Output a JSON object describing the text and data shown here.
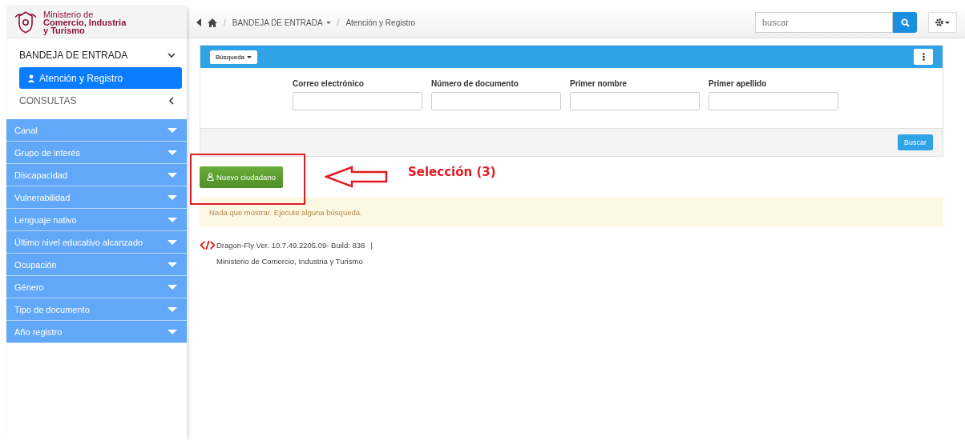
{
  "brand": {
    "lines": [
      "Ministerio de",
      "Comercio, Industria",
      "y Turismo"
    ]
  },
  "nav": [
    {
      "label": "BANDEJA DE ENTRADA",
      "expanded": true,
      "children": [
        {
          "label": "Atención y Registro",
          "selected": true
        }
      ]
    },
    {
      "label": "CONSULTAS",
      "expanded": false
    }
  ],
  "filters": [
    "Canal",
    "Grupo de interés",
    "Discapacidad",
    "Vulnerabilidad",
    "Lenguaje nativo",
    "Último nivel educativo alcanzado",
    "Ocupación",
    "Género",
    "Tipo de documento",
    "Año registro"
  ],
  "breadcrumb": [
    {
      "separator": "/",
      "label": "BANDEJA DE ENTRADA"
    },
    {
      "separator": "/",
      "label": "Atención y Registro"
    }
  ],
  "search": {
    "placeholder": "buscar"
  },
  "panel": {
    "menu": "Búsqueda",
    "fields": [
      "Correo electrónico",
      "Número de documento",
      "Primer nombre",
      "Primer apellido"
    ],
    "submit": "Buscar"
  },
  "new_button": "Nuevo ciudadano",
  "annotation": "Selección (3)",
  "alert": "Nada que mostrar. Ejecute alguna búsqueda.",
  "footer": {
    "version": "Dragon-Fly Ver. 10.7.49.2205.09- Build: 838",
    "separator": "|",
    "org": "Ministerio de Comercio, Industria y Turismo"
  }
}
